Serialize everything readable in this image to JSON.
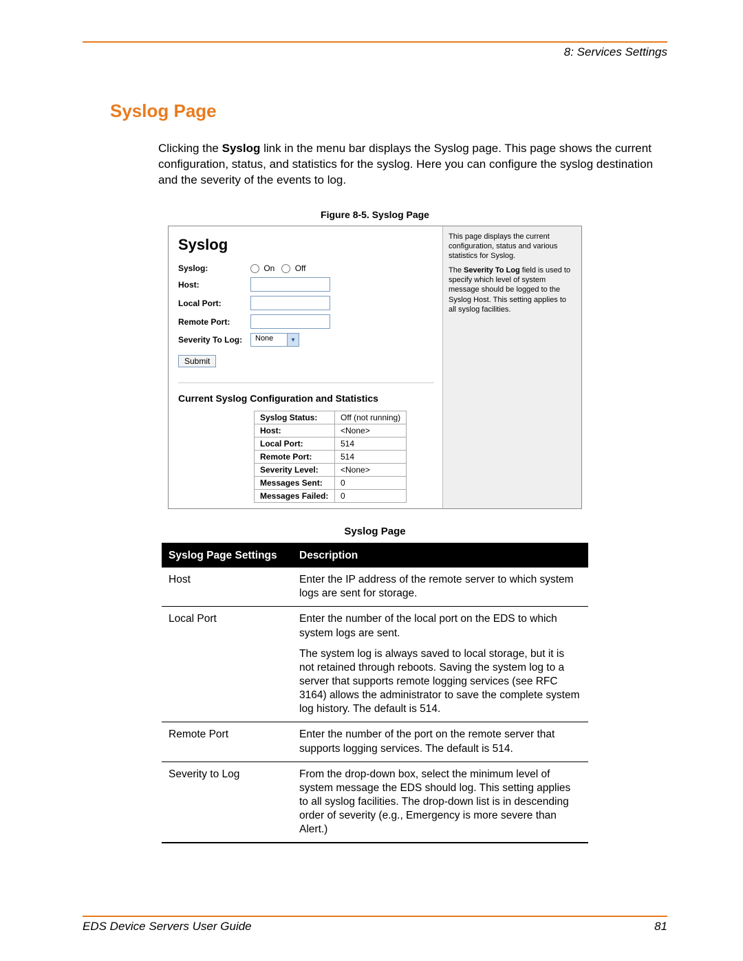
{
  "header": {
    "chapter": "8: Services Settings"
  },
  "h1": "Syslog Page",
  "intro": {
    "pre": "Clicking the ",
    "bold": "Syslog",
    "post": " link in the menu bar displays the Syslog page. This page shows the current configuration, status, and statistics for the syslog. Here you can configure the syslog destination and the severity of the events to log."
  },
  "figure_caption": "Figure 8-5. Syslog Page",
  "shot": {
    "title": "Syslog",
    "form": {
      "syslog_label": "Syslog:",
      "on": "On",
      "off": "Off",
      "host_label": "Host:",
      "local_port_label": "Local Port:",
      "remote_port_label": "Remote Port:",
      "severity_label": "Severity To Log:",
      "severity_value": "None",
      "submit": "Submit"
    },
    "stats_title": "Current Syslog Configuration and Statistics",
    "stats": [
      {
        "k": "Syslog Status:",
        "v": "Off (not running)"
      },
      {
        "k": "Host:",
        "v": "<None>"
      },
      {
        "k": "Local Port:",
        "v": "514"
      },
      {
        "k": "Remote Port:",
        "v": "514"
      },
      {
        "k": "Severity Level:",
        "v": "<None>"
      },
      {
        "k": "Messages Sent:",
        "v": "0"
      },
      {
        "k": "Messages Failed:",
        "v": "0"
      }
    ],
    "side": {
      "p1a": "This page displays the current configuration, status and various statistics for Syslog.",
      "p2a": "The ",
      "p2b": "Severity To Log",
      "p2c": " field is used to specify which level of system message should be logged to the Syslog Host. This setting applies to all syslog facilities."
    }
  },
  "desc_caption": "Syslog Page",
  "desc_table": {
    "h1": "Syslog Page Settings",
    "h2": "Description",
    "rows": [
      {
        "k": "Host",
        "v": [
          "Enter the IP address of the remote server to which system logs are sent for storage."
        ]
      },
      {
        "k": "Local Port",
        "v": [
          "Enter the number of the local port on the EDS to which system logs are sent.",
          "The system log is always saved to local storage, but it is not retained through reboots. Saving the system log to a server that supports remote logging services (see RFC 3164) allows the administrator to save the complete system log history. The default is 514."
        ]
      },
      {
        "k": "Remote Port",
        "v": [
          "Enter the number of the port on the remote server that supports logging services. The default is 514."
        ]
      },
      {
        "k": "Severity to Log",
        "v": [
          "From the drop-down box, select the minimum level of system message the EDS should log. This setting applies to all syslog facilities. The drop-down list is in descending order of severity (e.g., Emergency is more severe than Alert.)"
        ]
      }
    ]
  },
  "footer": {
    "title": "EDS Device Servers User Guide",
    "page": "81"
  }
}
